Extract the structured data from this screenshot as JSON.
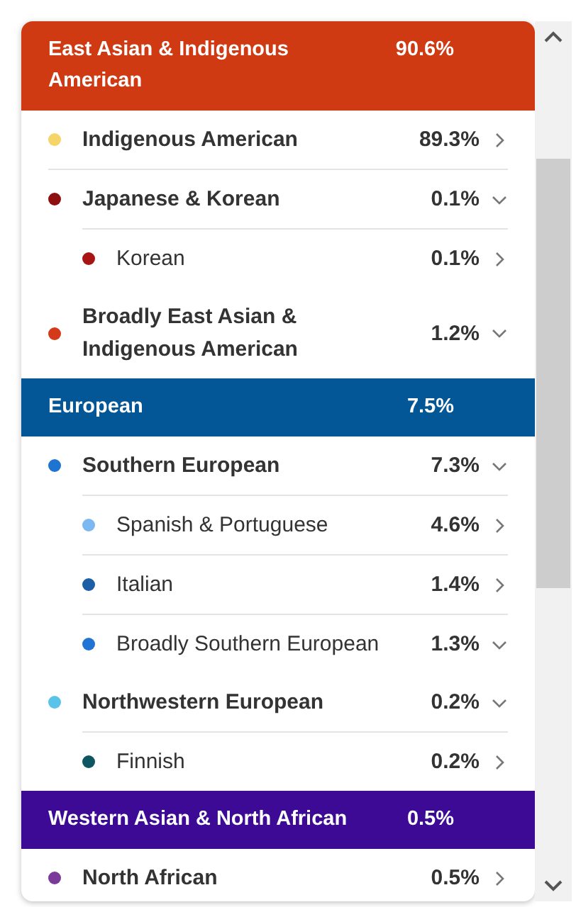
{
  "groups": [
    {
      "name": "East Asian & Indigenous American",
      "percent": "90.6%",
      "color": "#d03a12",
      "items": [
        {
          "name": "Indigenous American",
          "percent": "89.3%",
          "color": "#f5d56a",
          "expanded": false
        },
        {
          "name": "Japanese & Korean",
          "percent": "0.1%",
          "color": "#8e0f0f",
          "expanded": true,
          "children": [
            {
              "name": "Korean",
              "percent": "0.1%",
              "color": "#a81414",
              "expanded": false
            }
          ]
        },
        {
          "name": "Broadly East Asian & Indigenous American",
          "percent": "1.2%",
          "color": "#d43a1a",
          "expanded": true
        }
      ]
    },
    {
      "name": "European",
      "percent": "7.5%",
      "color": "#035796",
      "items": [
        {
          "name": "Southern European",
          "percent": "7.3%",
          "color": "#1f73d1",
          "expanded": true,
          "children": [
            {
              "name": "Spanish & Portuguese",
              "percent": "4.6%",
              "color": "#7cb9f0",
              "expanded": false
            },
            {
              "name": "Italian",
              "percent": "1.4%",
              "color": "#1d5fa6",
              "expanded": false
            },
            {
              "name": "Broadly Southern European",
              "percent": "1.3%",
              "color": "#2174d4",
              "expanded": true
            }
          ]
        },
        {
          "name": "Northwestern European",
          "percent": "0.2%",
          "color": "#5bc3ea",
          "expanded": true,
          "children": [
            {
              "name": "Finnish",
              "percent": "0.2%",
              "color": "#0d5560",
              "expanded": false
            }
          ]
        }
      ]
    },
    {
      "name": "Western Asian & North African",
      "percent": "0.5%",
      "color": "#3d0a96",
      "items": [
        {
          "name": "North African",
          "percent": "0.5%",
          "color": "#7b3a9a",
          "expanded": false
        }
      ]
    }
  ]
}
